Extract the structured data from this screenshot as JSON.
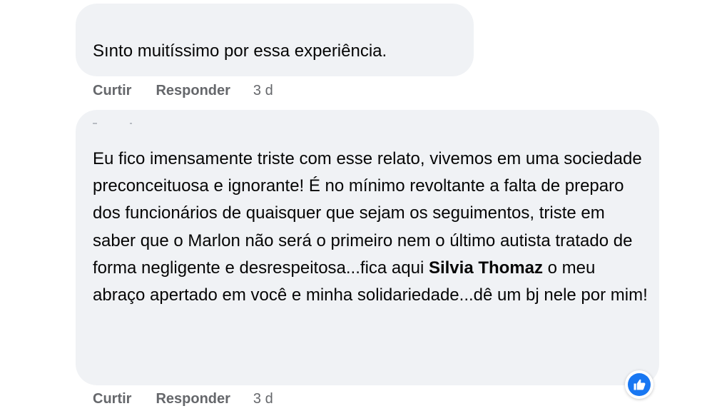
{
  "comments": [
    {
      "text": "Sınto muitíssimo por essa experiência.",
      "actions": {
        "like_label": "Curtir",
        "reply_label": "Responder",
        "timestamp": "3 d"
      }
    },
    {
      "text_before_mention": "Eu fico imensamente triste com esse relato, vivemos em uma sociedade preconceituosa e ignorante! É no mínimo revoltante a falta de preparo dos funcionários de quaisquer que sejam os seguimentos, triste em saber que o Marlon não será o primeiro nem o último autista tratado de forma negligente e desrespeitosa...fica aqui ",
      "mention": "Silvia Thomaz",
      "text_after_mention": " o meu abraço apertado em você e minha solidariedade...dê um bj nele por mim!",
      "reaction_icon": "like-icon",
      "reaction_color": "#1877f2",
      "actions": {
        "like_label": "Curtir",
        "reply_label": "Responder",
        "timestamp": "3 d"
      }
    }
  ]
}
